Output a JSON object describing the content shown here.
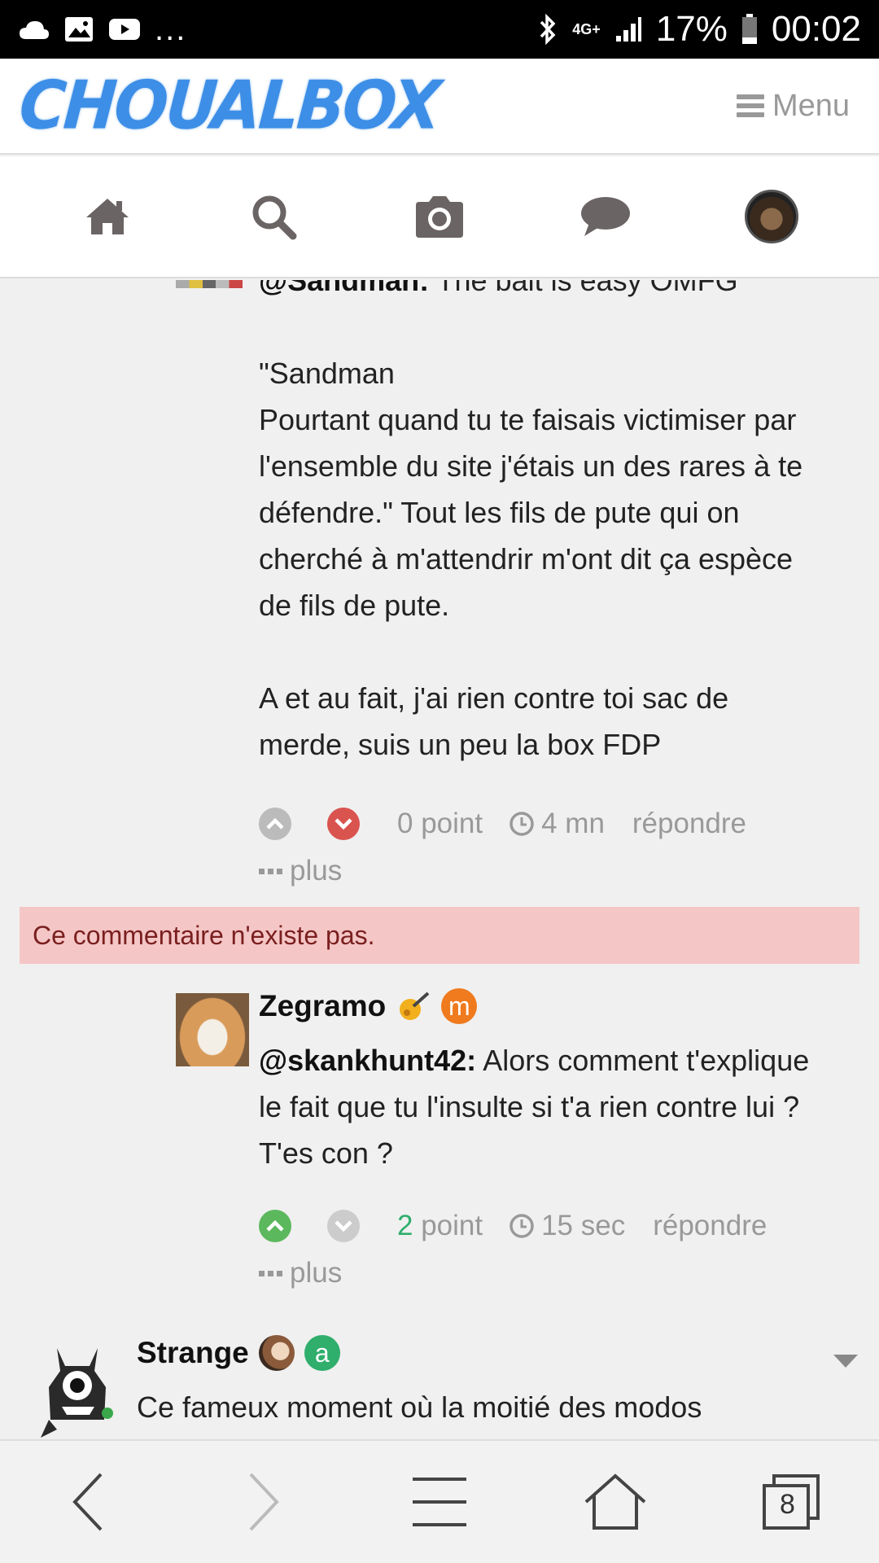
{
  "status_bar": {
    "overflow": "...",
    "network": "4G+",
    "battery": "17%",
    "time": "00:02"
  },
  "header": {
    "logo_text": "CHOUALBOX",
    "menu_label": "Menu"
  },
  "nav_icons": [
    "home-icon",
    "search-icon",
    "camera-icon",
    "chat-icon",
    "user-avatar"
  ],
  "comment1": {
    "mention": "@Sandman:",
    "first_line_rest": " The bait is easy OMFG",
    "body_lines": [
      "\"Sandman",
      "Pourtant quand tu te faisais victimiser par",
      "l'ensemble du site j'étais un des rares à te",
      "défendre.\" Tout les fils de pute qui on",
      "cherché à m'attendrir m'ont dit ça espèce",
      "de fils de pute."
    ],
    "body_lines_2": [
      "A et au fait, j'ai rien contre toi sac de",
      "merde, suis un peu la box FDP"
    ],
    "points": "0 point",
    "time": "4 mn",
    "reply": "répondre",
    "more": "plus"
  },
  "notice": "Ce commentaire n'existe pas.",
  "comment2": {
    "username": "Zegramo",
    "badge": "m",
    "mention": "@skankhunt42:",
    "lines": [
      " Alors comment t'explique",
      "le fait que tu l'insulte si t'a rien contre lui ?",
      "T'es con ?"
    ],
    "points_value": "2",
    "points_label": " point",
    "time": "15 sec",
    "reply": "répondre",
    "more": "plus"
  },
  "comment3": {
    "username": "Strange",
    "badge": "a",
    "line1": "Ce fameux moment où la moitié des modos"
  },
  "bottom_bar": {
    "tabs_count": "8"
  },
  "colors": {
    "logo": "#3d8ee6",
    "upvote_active": "#5cb85c",
    "downvote_active": "#d9534f",
    "vote_inactive": "#bbbbbb",
    "notice_bg": "#f5c6c6",
    "points_green": "#2fae6c"
  }
}
